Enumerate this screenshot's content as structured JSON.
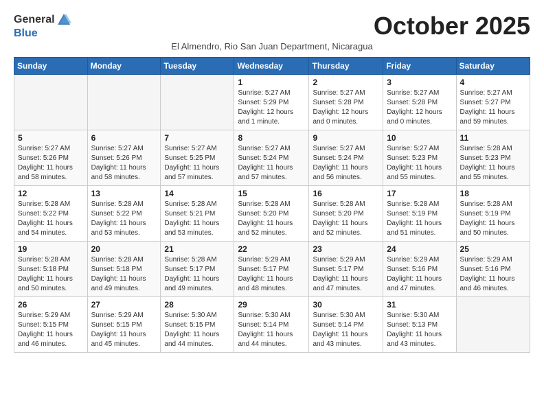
{
  "logo": {
    "general": "General",
    "blue": "Blue"
  },
  "title": "October 2025",
  "subtitle": "El Almendro, Rio San Juan Department, Nicaragua",
  "days_of_week": [
    "Sunday",
    "Monday",
    "Tuesday",
    "Wednesday",
    "Thursday",
    "Friday",
    "Saturday"
  ],
  "weeks": [
    [
      {
        "day": "",
        "info": ""
      },
      {
        "day": "",
        "info": ""
      },
      {
        "day": "",
        "info": ""
      },
      {
        "day": "1",
        "info": "Sunrise: 5:27 AM\nSunset: 5:29 PM\nDaylight: 12 hours\nand 1 minute."
      },
      {
        "day": "2",
        "info": "Sunrise: 5:27 AM\nSunset: 5:28 PM\nDaylight: 12 hours\nand 0 minutes."
      },
      {
        "day": "3",
        "info": "Sunrise: 5:27 AM\nSunset: 5:28 PM\nDaylight: 12 hours\nand 0 minutes."
      },
      {
        "day": "4",
        "info": "Sunrise: 5:27 AM\nSunset: 5:27 PM\nDaylight: 11 hours\nand 59 minutes."
      }
    ],
    [
      {
        "day": "5",
        "info": "Sunrise: 5:27 AM\nSunset: 5:26 PM\nDaylight: 11 hours\nand 58 minutes."
      },
      {
        "day": "6",
        "info": "Sunrise: 5:27 AM\nSunset: 5:26 PM\nDaylight: 11 hours\nand 58 minutes."
      },
      {
        "day": "7",
        "info": "Sunrise: 5:27 AM\nSunset: 5:25 PM\nDaylight: 11 hours\nand 57 minutes."
      },
      {
        "day": "8",
        "info": "Sunrise: 5:27 AM\nSunset: 5:24 PM\nDaylight: 11 hours\nand 57 minutes."
      },
      {
        "day": "9",
        "info": "Sunrise: 5:27 AM\nSunset: 5:24 PM\nDaylight: 11 hours\nand 56 minutes."
      },
      {
        "day": "10",
        "info": "Sunrise: 5:27 AM\nSunset: 5:23 PM\nDaylight: 11 hours\nand 55 minutes."
      },
      {
        "day": "11",
        "info": "Sunrise: 5:28 AM\nSunset: 5:23 PM\nDaylight: 11 hours\nand 55 minutes."
      }
    ],
    [
      {
        "day": "12",
        "info": "Sunrise: 5:28 AM\nSunset: 5:22 PM\nDaylight: 11 hours\nand 54 minutes."
      },
      {
        "day": "13",
        "info": "Sunrise: 5:28 AM\nSunset: 5:22 PM\nDaylight: 11 hours\nand 53 minutes."
      },
      {
        "day": "14",
        "info": "Sunrise: 5:28 AM\nSunset: 5:21 PM\nDaylight: 11 hours\nand 53 minutes."
      },
      {
        "day": "15",
        "info": "Sunrise: 5:28 AM\nSunset: 5:20 PM\nDaylight: 11 hours\nand 52 minutes."
      },
      {
        "day": "16",
        "info": "Sunrise: 5:28 AM\nSunset: 5:20 PM\nDaylight: 11 hours\nand 52 minutes."
      },
      {
        "day": "17",
        "info": "Sunrise: 5:28 AM\nSunset: 5:19 PM\nDaylight: 11 hours\nand 51 minutes."
      },
      {
        "day": "18",
        "info": "Sunrise: 5:28 AM\nSunset: 5:19 PM\nDaylight: 11 hours\nand 50 minutes."
      }
    ],
    [
      {
        "day": "19",
        "info": "Sunrise: 5:28 AM\nSunset: 5:18 PM\nDaylight: 11 hours\nand 50 minutes."
      },
      {
        "day": "20",
        "info": "Sunrise: 5:28 AM\nSunset: 5:18 PM\nDaylight: 11 hours\nand 49 minutes."
      },
      {
        "day": "21",
        "info": "Sunrise: 5:28 AM\nSunset: 5:17 PM\nDaylight: 11 hours\nand 49 minutes."
      },
      {
        "day": "22",
        "info": "Sunrise: 5:29 AM\nSunset: 5:17 PM\nDaylight: 11 hours\nand 48 minutes."
      },
      {
        "day": "23",
        "info": "Sunrise: 5:29 AM\nSunset: 5:17 PM\nDaylight: 11 hours\nand 47 minutes."
      },
      {
        "day": "24",
        "info": "Sunrise: 5:29 AM\nSunset: 5:16 PM\nDaylight: 11 hours\nand 47 minutes."
      },
      {
        "day": "25",
        "info": "Sunrise: 5:29 AM\nSunset: 5:16 PM\nDaylight: 11 hours\nand 46 minutes."
      }
    ],
    [
      {
        "day": "26",
        "info": "Sunrise: 5:29 AM\nSunset: 5:15 PM\nDaylight: 11 hours\nand 46 minutes."
      },
      {
        "day": "27",
        "info": "Sunrise: 5:29 AM\nSunset: 5:15 PM\nDaylight: 11 hours\nand 45 minutes."
      },
      {
        "day": "28",
        "info": "Sunrise: 5:30 AM\nSunset: 5:15 PM\nDaylight: 11 hours\nand 44 minutes."
      },
      {
        "day": "29",
        "info": "Sunrise: 5:30 AM\nSunset: 5:14 PM\nDaylight: 11 hours\nand 44 minutes."
      },
      {
        "day": "30",
        "info": "Sunrise: 5:30 AM\nSunset: 5:14 PM\nDaylight: 11 hours\nand 43 minutes."
      },
      {
        "day": "31",
        "info": "Sunrise: 5:30 AM\nSunset: 5:13 PM\nDaylight: 11 hours\nand 43 minutes."
      },
      {
        "day": "",
        "info": ""
      }
    ]
  ]
}
